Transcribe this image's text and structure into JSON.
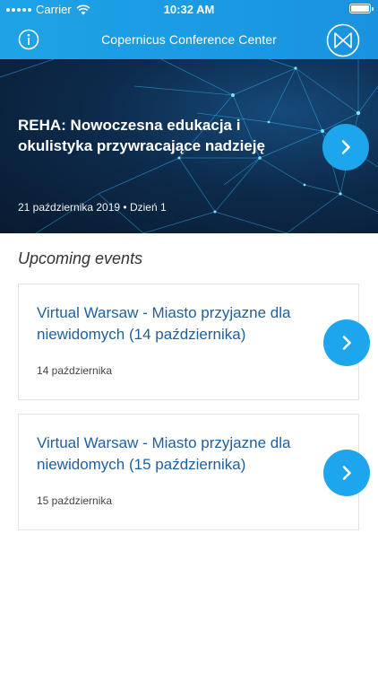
{
  "status_bar": {
    "carrier": "Carrier",
    "time": "10:32 AM"
  },
  "header": {
    "title": "Copernicus Conference Center"
  },
  "hero": {
    "title": "REHA: Nowoczesna edukacja i okulistyka przywracające nadzieję",
    "date": "21 października 2019 • Dzień 1"
  },
  "upcoming": {
    "heading": "Upcoming events",
    "events": [
      {
        "title": "Virtual Warsaw - Miasto przyjazne dla niewidomych (14 października)",
        "date": "14 października"
      },
      {
        "title": "Virtual Warsaw - Miasto przyjazne dla niewidomych (15 października)",
        "date": "15 października"
      }
    ]
  },
  "colors": {
    "header": "#1b9be3",
    "accent": "#1ea6ec",
    "link": "#1e5f9e"
  },
  "icons": {
    "info": "info-icon",
    "logo": "conference-logo-icon",
    "arrow": "chevron-right-icon"
  }
}
